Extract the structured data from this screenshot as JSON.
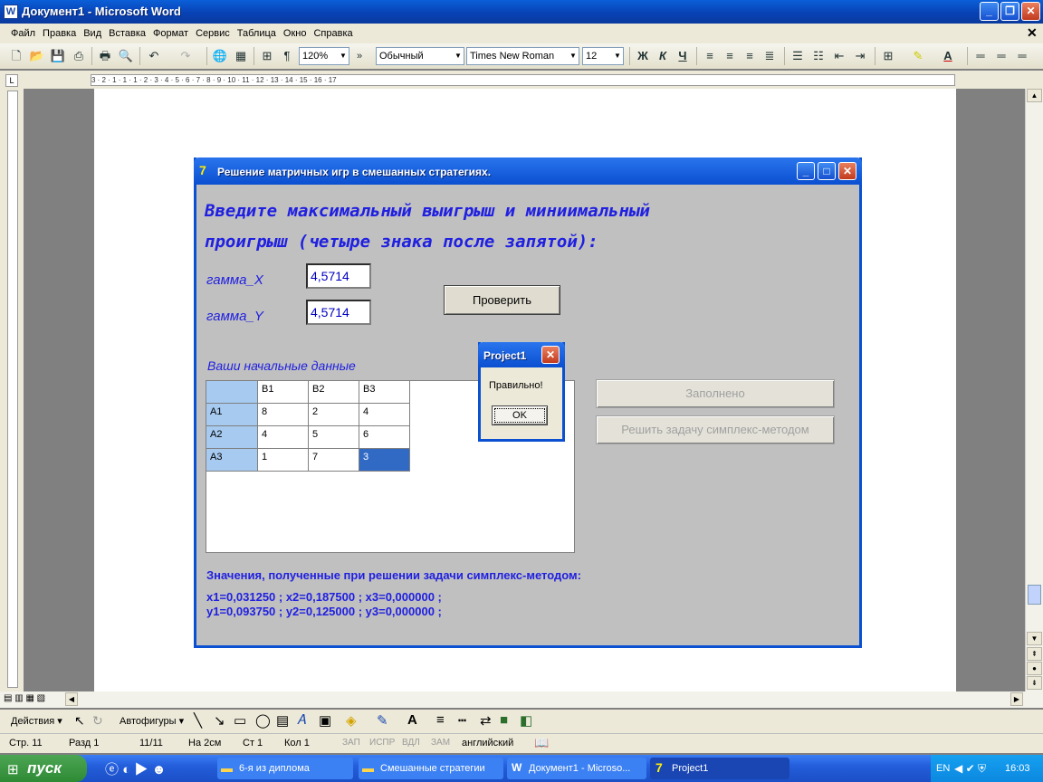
{
  "word": {
    "title": "Документ1 - Microsoft Word",
    "menu": [
      "Файл",
      "Правка",
      "Вид",
      "Вставка",
      "Формат",
      "Сервис",
      "Таблица",
      "Окно",
      "Справка"
    ],
    "zoom": "120%",
    "style": "Обычный",
    "font": "Times New Roman",
    "size": "12",
    "bold": "Ж",
    "italic": "К",
    "underline": "Ч",
    "ruler_text": "3 · 2 · 1 · 1 · 1 · 2 · 3 · 4 · 5 · 6 · 7 · 8 · 9 · 10 · 11 · 12 · 13 · 14 · 15 · 16 · 17",
    "draw_actions": "Действия ▾",
    "draw_shapes": "Автофигуры ▾",
    "status": {
      "page": "Стр. 11",
      "section": "Разд 1",
      "pages": "11/11",
      "at": "На 2см",
      "line": "Ст 1",
      "col": "Кол 1",
      "rec": "ЗАП",
      "trk": "ИСПР",
      "ext": "ВДЛ",
      "ovr": "ЗАМ",
      "lang": "английский"
    }
  },
  "app": {
    "title": "Решение матричных игр в смешанных стратегиях.",
    "heading_line1": "Введите максимальный выигрыш и миниимальный",
    "heading_line2": "проигрыш (четыре знака после запятой):",
    "gamma_x_label": "гамма_X",
    "gamma_x_value": "4,5714",
    "gamma_y_label": "гамма_Y",
    "gamma_y_value": "4,5714",
    "check_button": "Проверить",
    "initial_data_label": "Ваши начальные данные",
    "filled_button": "Заполнено",
    "solve_button": "Решить задачу симплекс-методом",
    "grid": {
      "columns": [
        "",
        "B1",
        "B2",
        "B3"
      ],
      "rows": [
        [
          "A1",
          "8",
          "2",
          "4"
        ],
        [
          "A2",
          "4",
          "5",
          "6"
        ],
        [
          "A3",
          "1",
          "7",
          "3"
        ]
      ]
    },
    "result_title": "Значения, полученные при решении задачи симплекс-методом:",
    "result_x": "x1=0,031250 ; x2=0,187500 ; x3=0,000000 ;",
    "result_y": "y1=0,093750 ; y2=0,125000 ; y3=0,000000 ;"
  },
  "msgbox": {
    "title": "Project1",
    "text": "Правильно!",
    "ok": "OK"
  },
  "taskbar": {
    "start": "пуск",
    "tasks": [
      "6-я из диплома",
      "Смешанные стратегии",
      "Документ1 - Microso...",
      "Project1"
    ],
    "lang": "EN",
    "clock": "16:03"
  }
}
